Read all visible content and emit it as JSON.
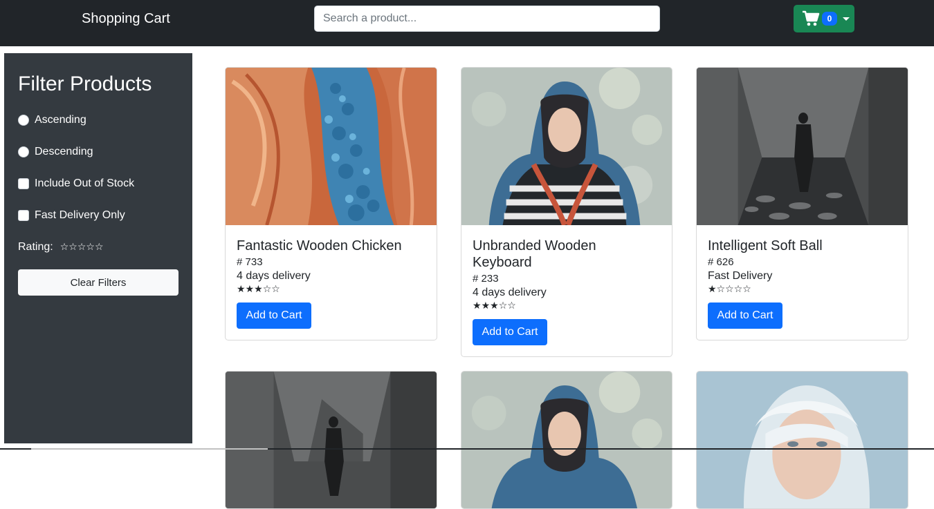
{
  "navbar": {
    "brand": "Shopping Cart",
    "search_placeholder": "Search a product...",
    "cart_count": "0",
    "cart_icon": "shopping-cart-icon"
  },
  "sidebar": {
    "title": "Filter Products",
    "ascending": "Ascending",
    "descending": "Descending",
    "out_of_stock": "Include Out of Stock",
    "fast_delivery": "Fast Delivery Only",
    "rating_label": "Rating:",
    "rating_value": 0,
    "clear_label": "Clear Filters"
  },
  "products": [
    {
      "title": "Fantastic Wooden Chicken",
      "id": "# 733",
      "delivery": "4 days delivery",
      "rating": 3,
      "button": "Add to Cart",
      "image": "orange-canyon-blue-stones"
    },
    {
      "title": "Unbranded Wooden Keyboard",
      "id": "# 233",
      "delivery": "4 days delivery",
      "rating": 3,
      "button": "Add to Cart",
      "image": "woman-in-scarf"
    },
    {
      "title": "Intelligent Soft Ball",
      "id": "# 626",
      "delivery": "Fast Delivery",
      "rating": 1,
      "button": "Add to Cart",
      "image": "man-in-concrete-hall"
    },
    {
      "image": "man-in-concrete-hall"
    },
    {
      "image": "woman-in-scarf"
    },
    {
      "image": "white-haired-woman"
    }
  ],
  "colors": {
    "navbar": "#212529",
    "sidebar": "#343a40",
    "cart_button": "#198754",
    "primary": "#0d6efd"
  }
}
